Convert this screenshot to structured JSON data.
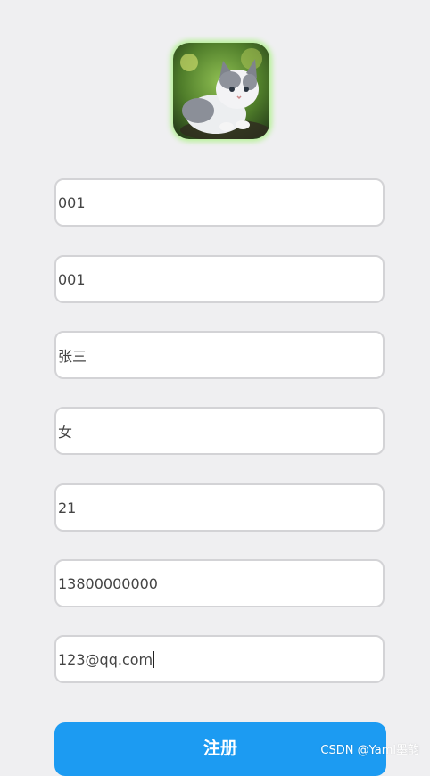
{
  "avatar": {
    "icon": "kitten-avatar-image"
  },
  "form": {
    "fields": [
      {
        "name": "field-1",
        "value": "001"
      },
      {
        "name": "field-2",
        "value": "001"
      },
      {
        "name": "field-name",
        "value": "张三"
      },
      {
        "name": "field-gender",
        "value": "女"
      },
      {
        "name": "field-age",
        "value": "21"
      },
      {
        "name": "field-phone",
        "value": "13800000000"
      },
      {
        "name": "field-email",
        "value": "123@qq.com"
      }
    ],
    "submit_label": "注册"
  },
  "watermark": "CSDN @Yaml墨韵",
  "colors": {
    "accent": "#1c9bf2",
    "background": "#efeff1",
    "field_border": "#d3d3d6",
    "avatar_glow": "#b8f09a"
  }
}
